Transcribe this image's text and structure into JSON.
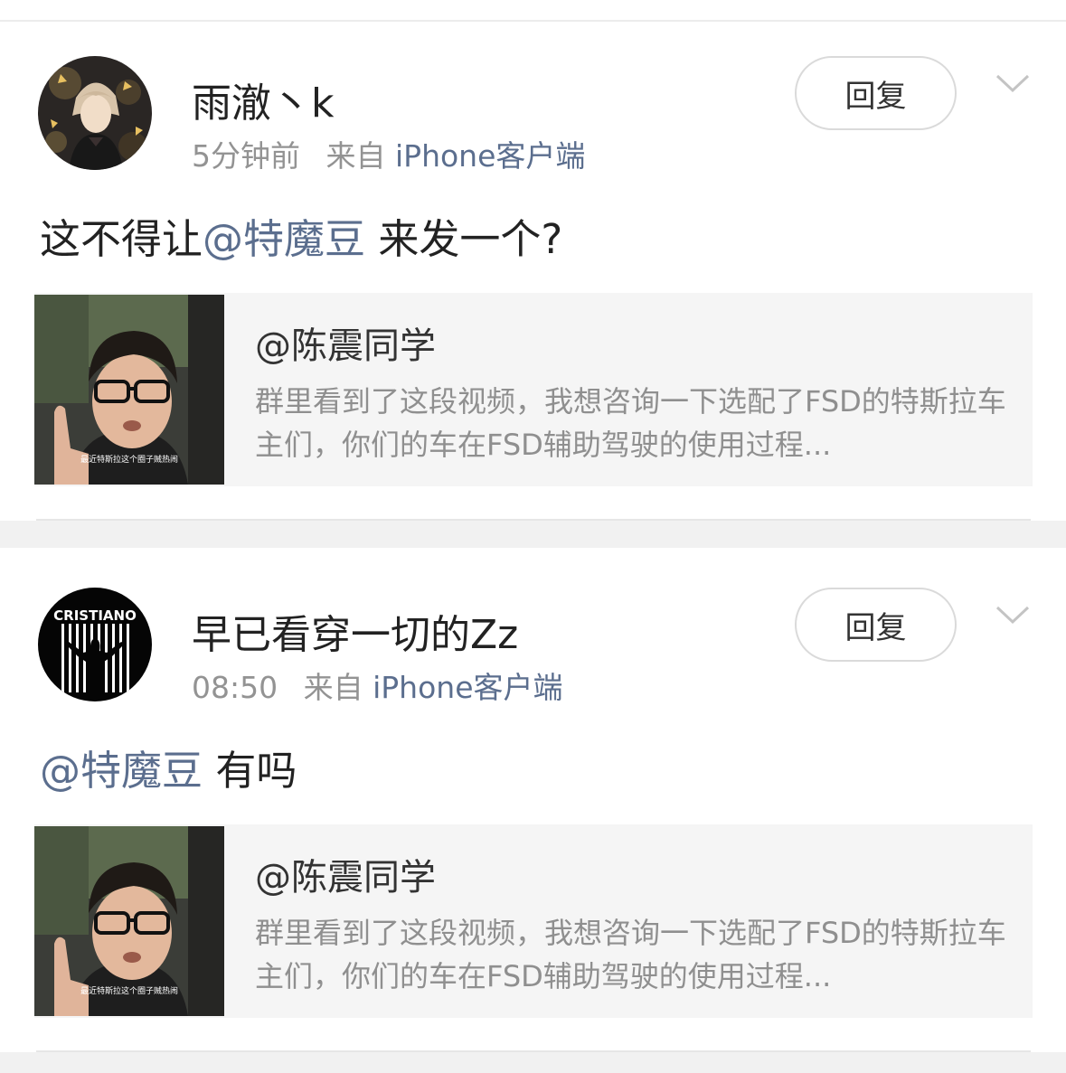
{
  "comments": [
    {
      "username": "雨澈丶k",
      "time": "5分钟前",
      "source_prefix": "来自",
      "source": "iPhone客户端",
      "reply_label": "回复",
      "mention": "@特魔豆",
      "text_before": "这不得让",
      "text_after": " 来发一个?",
      "embed": {
        "author": "@陈震同学",
        "text": "群里看到了这段视频，我想咨询一下选配了FSD的特斯拉车主们，你们的车在FSD辅助驾驶的使用过程...",
        "thumb_caption": "最近特斯拉这个圈子贼热闹"
      }
    },
    {
      "username": "早已看穿一切的Zz",
      "time": "08:50",
      "source_prefix": "来自",
      "source": "iPhone客户端",
      "reply_label": "回复",
      "mention": "@特魔豆",
      "text_before": "",
      "text_after": " 有吗",
      "avatar_text": "CRISTIANO",
      "embed": {
        "author": "@陈震同学",
        "text": "群里看到了这段视频，我想咨询一下选配了FSD的特斯拉车主们，你们的车在FSD辅助驾驶的使用过程...",
        "thumb_caption": "最近特斯拉这个圈子贼热闹"
      }
    }
  ],
  "colors": {
    "link": "#5b6e8e",
    "meta": "#939393",
    "embed_bg": "#f5f5f5",
    "divider_band": "#f1f1f1"
  }
}
